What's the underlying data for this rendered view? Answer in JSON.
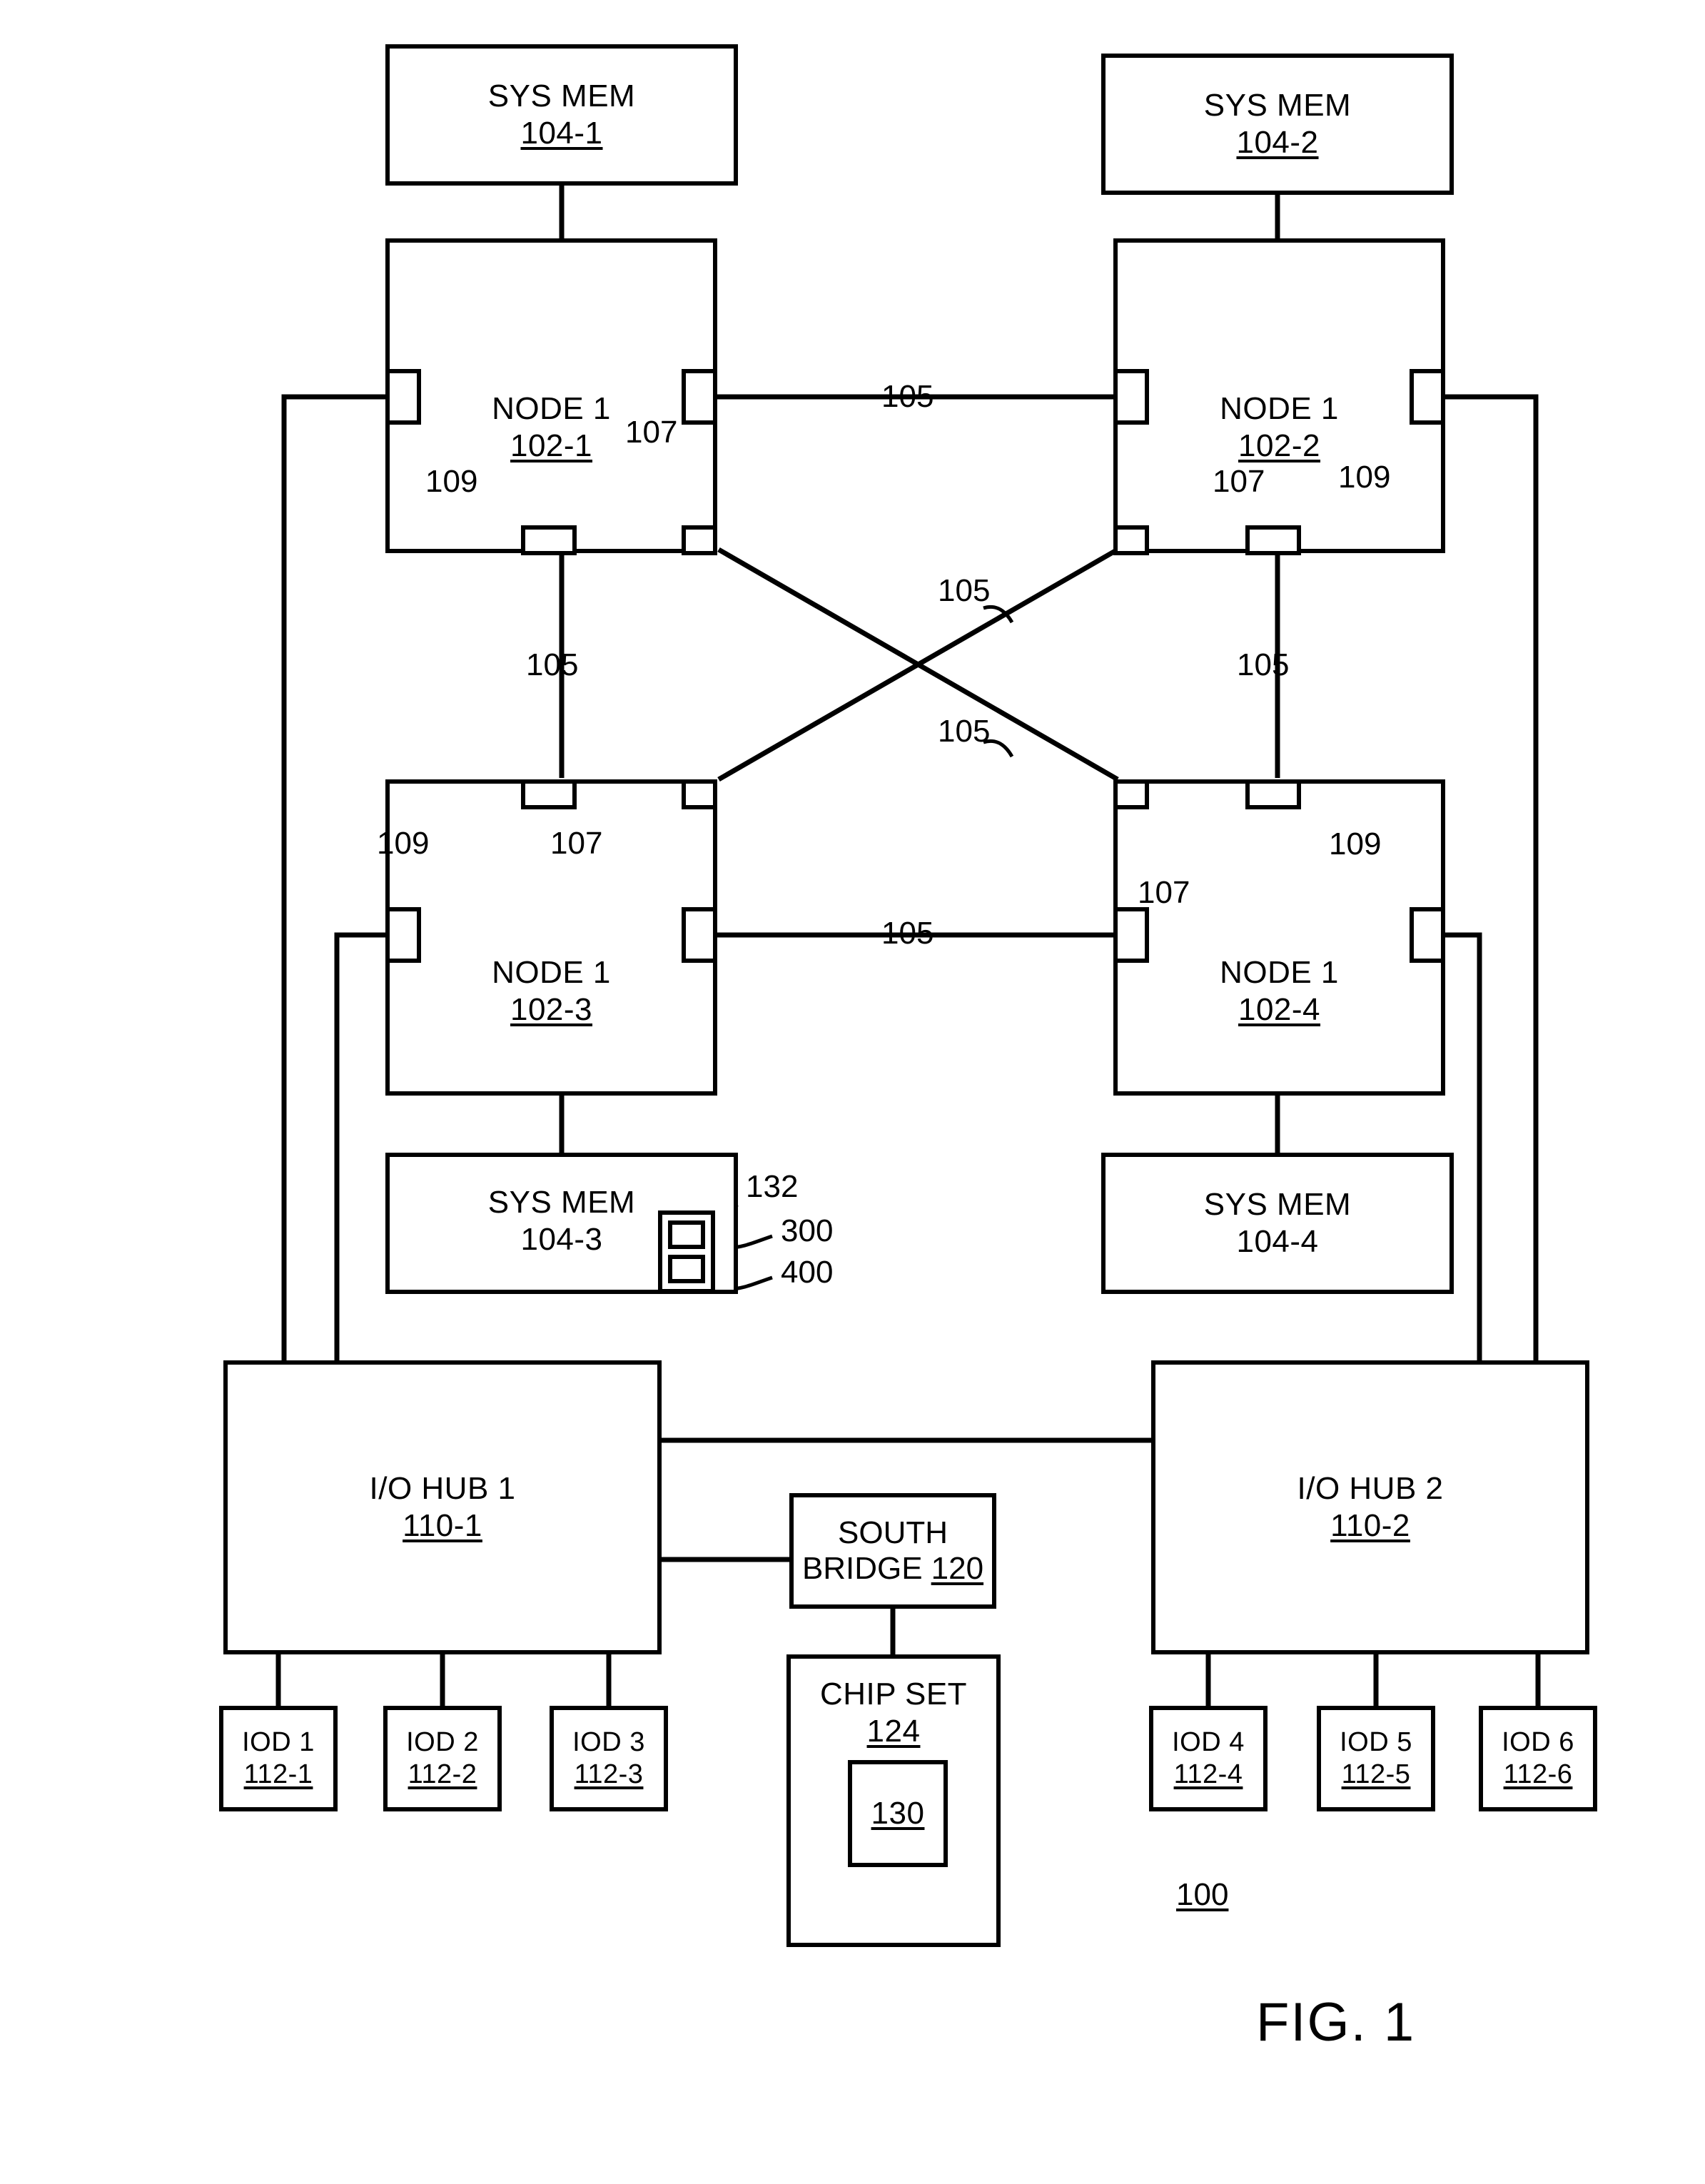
{
  "figure": {
    "label": "FIG. 1",
    "system_ref": "100"
  },
  "memories": [
    {
      "name": "sys-mem-104-1",
      "title": "SYS MEM",
      "ref": "104-1",
      "ref_underlined": true
    },
    {
      "name": "sys-mem-104-2",
      "title": "SYS MEM",
      "ref": "104-2",
      "ref_underlined": true
    },
    {
      "name": "sys-mem-104-3",
      "title": "SYS MEM",
      "ref": "104-3",
      "ref_underlined": false
    },
    {
      "name": "sys-mem-104-4",
      "title": "SYS MEM",
      "ref": "104-4",
      "ref_underlined": false
    }
  ],
  "nodes": [
    {
      "name": "node-102-1",
      "title": "NODE 1",
      "ref": "102-1"
    },
    {
      "name": "node-102-2",
      "title": "NODE 1",
      "ref": "102-2"
    },
    {
      "name": "node-102-3",
      "title": "NODE 1",
      "ref": "102-3"
    },
    {
      "name": "node-102-4",
      "title": "NODE 1",
      "ref": "102-4"
    }
  ],
  "io_hubs": [
    {
      "name": "io-hub-1",
      "title": "I/O HUB 1",
      "ref": "110-1"
    },
    {
      "name": "io-hub-2",
      "title": "I/O HUB 2",
      "ref": "110-2"
    }
  ],
  "south_bridge": {
    "line1": "SOUTH",
    "line2": "BRIDGE",
    "ref": "120"
  },
  "chip_set": {
    "title": "CHIP SET",
    "ref": "124",
    "inner_ref": "130"
  },
  "io_devices": [
    {
      "name": "iod-112-1",
      "title": "IOD 1",
      "ref": "112-1"
    },
    {
      "name": "iod-112-2",
      "title": "IOD 2",
      "ref": "112-2"
    },
    {
      "name": "iod-112-3",
      "title": "IOD 3",
      "ref": "112-3"
    },
    {
      "name": "iod-112-4",
      "title": "IOD 4",
      "ref": "112-4"
    },
    {
      "name": "iod-112-5",
      "title": "IOD 5",
      "ref": "112-5"
    },
    {
      "name": "iod-112-6",
      "title": "IOD 6",
      "ref": "112-6"
    }
  ],
  "memory_region": {
    "region_ref": "132",
    "cell_refs": [
      "300",
      "400"
    ]
  },
  "link_labels": {
    "interconnect": "105",
    "coherent_port": "107",
    "io_port": "109"
  },
  "callouts": {
    "link_105_top": "105",
    "link_105_left_vert": "105",
    "link_105_right_vert": "105",
    "link_105_cross_upper": "105",
    "link_105_cross_lower": "105",
    "link_105_bottom": "105",
    "port_107_n1": "107",
    "port_107_n2": "107",
    "port_107_n3": "107",
    "port_107_n4": "107",
    "port_109_n1": "109",
    "port_109_n2": "109",
    "port_109_n3": "109",
    "port_109_n4": "109",
    "region_132": "132",
    "cell_300": "300",
    "cell_400": "400"
  }
}
